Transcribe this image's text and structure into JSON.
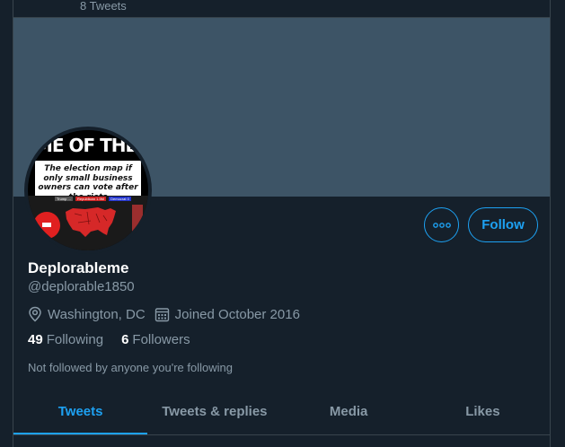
{
  "header": {
    "tweet_count": "8 Tweets"
  },
  "profile": {
    "name": "Deplorableme",
    "handle": "@deplorable1850",
    "location": "Washington, DC",
    "joined": "Joined October 2016",
    "following_count": "49",
    "following_label": "Following",
    "followers_count": "6",
    "followers_label": "Followers",
    "not_followed_note": "Not followed by anyone you're following"
  },
  "avatar": {
    "headline": "ME OF THE D",
    "caption": "The election map if only small business owners can vote after the riots",
    "legend": [
      "Trump ...",
      "Republican 1.5M",
      "Democrat 0"
    ]
  },
  "actions": {
    "more_icon": "more-horizontal-icon",
    "follow_label": "Follow"
  },
  "tabs": [
    {
      "label": "Tweets",
      "active": true
    },
    {
      "label": "Tweets & replies",
      "active": false
    },
    {
      "label": "Media",
      "active": false
    },
    {
      "label": "Likes",
      "active": false
    }
  ],
  "colors": {
    "background": "#15202b",
    "banner": "#3d5466",
    "accent": "#1da1f2",
    "secondary_text": "#8899a6",
    "border": "#38444d"
  }
}
